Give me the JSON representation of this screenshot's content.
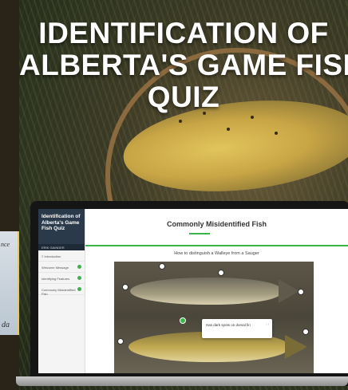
{
  "poster": {
    "title_lines": [
      "IDENTIFICATION OF",
      "ALBERTA'S GAME FISH",
      "QUIZ"
    ]
  },
  "left_card": {
    "text_top": "nce",
    "text_bottom": "da"
  },
  "app": {
    "sidebar": {
      "course_title": "Identification of Alberta's Game Fish Quiz",
      "author": "ERIK GAINDER",
      "items": [
        {
          "label": "≡ Introduction",
          "status": "none"
        },
        {
          "label": "Welcome Message",
          "status": "complete"
        },
        {
          "label": "Identifying Features",
          "status": "complete"
        },
        {
          "label": "Commonly Misidentified Fish",
          "status": "complete"
        }
      ]
    },
    "lesson": {
      "title": "Commonly Misidentified Fish",
      "subtitle": "How to distinguish a Walleye from a Sauger"
    },
    "tooltip": {
      "text": "Has dark spots on dorsal fin",
      "nav": "‹ ›"
    }
  },
  "colors": {
    "accent": "#3ab54a",
    "sidebar_header": "#2b3a4a"
  }
}
